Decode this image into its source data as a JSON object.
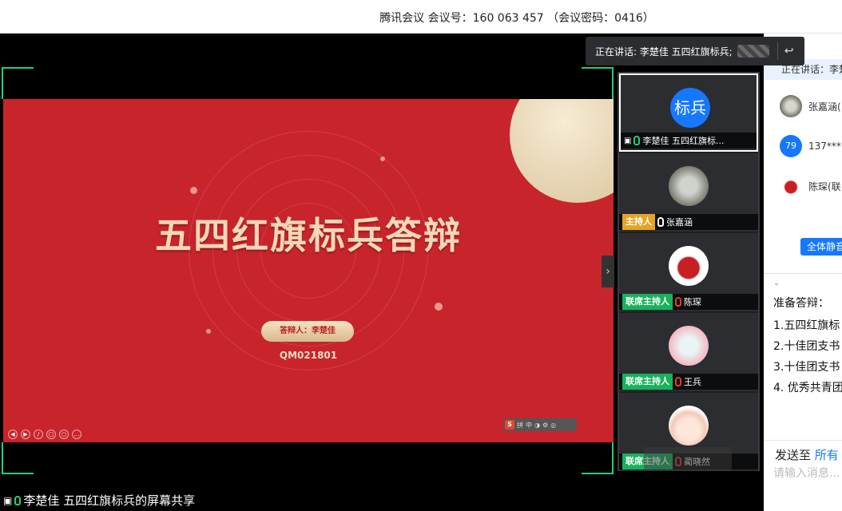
{
  "titlebar": {
    "text": "腾讯会议 会议号：160 063 457 （会议密码：0416）"
  },
  "speaking_popup": {
    "label": "正在讲话: 李楚佳 五四红旗标兵;"
  },
  "slide": {
    "title": "五四红旗标兵答辩",
    "presenter": "答辩人：李楚佳",
    "code": "QM021801",
    "tools": [
      "S",
      "拼",
      "中",
      "◑",
      "⚙",
      "◎"
    ]
  },
  "share_bar": {
    "text": "李楚佳 五四红旗标兵的屏幕共享"
  },
  "gallery": [
    {
      "avatar_text": "标兵",
      "name": "李楚佳 五四红旗标...",
      "tag": ""
    },
    {
      "avatar_text": "",
      "name": "张嘉涵",
      "tag": "主持人"
    },
    {
      "avatar_text": "",
      "name": "陈琛",
      "tag": "联席主持人"
    },
    {
      "avatar_text": "",
      "name": "王兵",
      "tag": "联席主持人"
    },
    {
      "avatar_text": "",
      "name": "蔺晓然",
      "tag": "联席主持人"
    }
  ],
  "panel": {
    "speaking": "正在讲话：李楚",
    "members": [
      {
        "avatar": "",
        "name": "张嘉涵("
      },
      {
        "avatar": "79",
        "name": "137***"
      },
      {
        "avatar": "",
        "name": "陈琛(联"
      }
    ],
    "mute_all": "全体静音",
    "chat_lines": [
      "准备答辩：",
      "1.五四红旗标",
      "2.十佳团支书",
      "3.十佳团支书",
      "4. 优秀共青团"
    ],
    "send_to_label": "发送至",
    "send_to_target": "所有",
    "input_placeholder": "请输入消息..."
  }
}
